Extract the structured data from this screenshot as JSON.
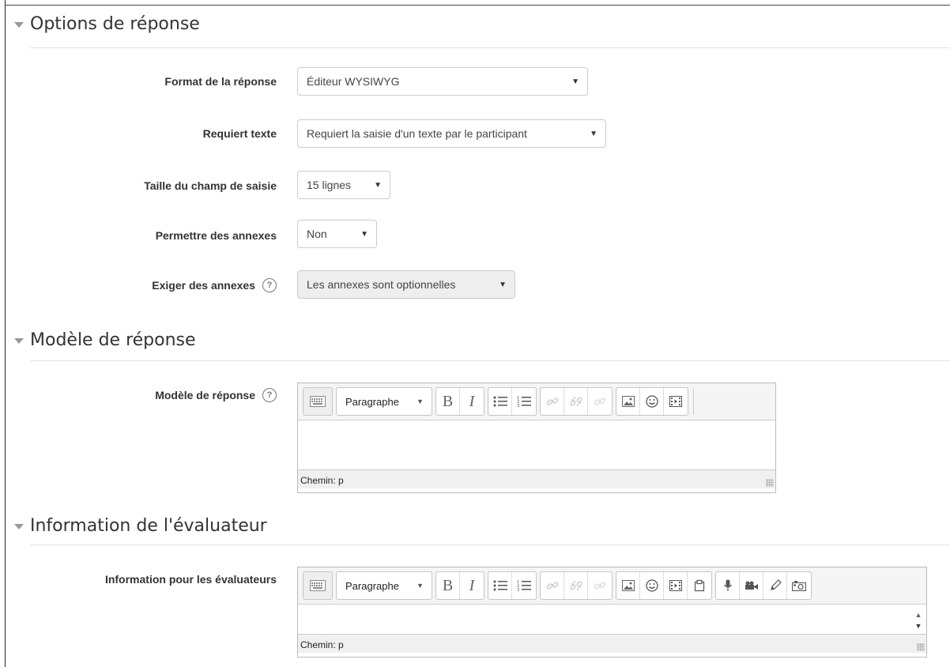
{
  "sections": {
    "options": {
      "title": "Options de réponse"
    },
    "model": {
      "title": "Modèle de réponse"
    },
    "grader": {
      "title": "Information de l'évaluateur"
    }
  },
  "fields": {
    "response_format": {
      "label": "Format de la réponse",
      "value": "Éditeur WYSIWYG"
    },
    "response_required": {
      "label": "Requiert texte",
      "value": "Requiert la saisie d'un texte par le participant"
    },
    "field_lines": {
      "label": "Taille du champ de saisie",
      "value": "15 lignes"
    },
    "attachments": {
      "label": "Permettre des annexes",
      "value": "Non"
    },
    "attachments_required": {
      "label": "Exiger des annexes",
      "value": "Les annexes sont optionnelles"
    },
    "response_template": {
      "label": "Modèle de réponse"
    },
    "grader_info": {
      "label": "Information pour les évaluateurs"
    }
  },
  "editor": {
    "paragraph_label": "Paragraphe",
    "bold_label": "B",
    "italic_label": "I",
    "path_text": "Chemin: p"
  },
  "icons": {
    "help": "?",
    "dropdown": "▼",
    "scroll_up": "▲",
    "scroll_down": "▼"
  }
}
